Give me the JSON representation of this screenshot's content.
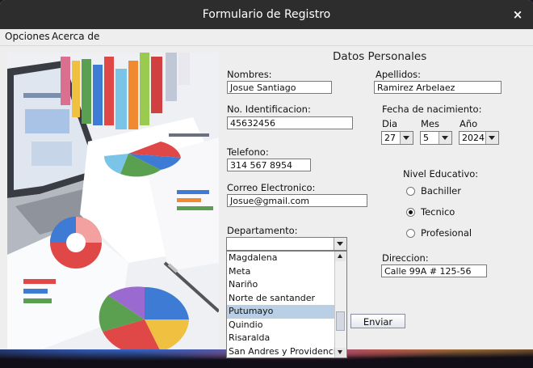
{
  "window": {
    "title": "Formulario de Registro",
    "close_glyph": "×"
  },
  "menu": {
    "items": [
      "Opciones",
      "Acerca de"
    ]
  },
  "image": {
    "icon": "business-charts-illustration"
  },
  "form": {
    "section_title": "Datos Personales",
    "nombres": {
      "label": "Nombres:",
      "value": "Josue Santiago"
    },
    "apellidos": {
      "label": "Apellidos:",
      "value": "Ramirez Arbelaez"
    },
    "identificacion": {
      "label": "No. Identificacion:",
      "value": "45632456"
    },
    "fecha": {
      "label": "Fecha de nacimiento:",
      "dia": {
        "label": "Dia",
        "value": "27"
      },
      "mes": {
        "label": "Mes",
        "value": "5"
      },
      "anio": {
        "label": "Año",
        "value": "2024"
      }
    },
    "telefono": {
      "label": "Telefono:",
      "value": "314 567 8954"
    },
    "correo": {
      "label": "Correo Electronico:",
      "value": "Josue@gmail.com"
    },
    "nivel": {
      "label": "Nivel Educativo:",
      "options": [
        "Bachiller",
        "Tecnico",
        "Profesional"
      ],
      "selected": "Tecnico"
    },
    "departamento": {
      "label": "Departamento:",
      "value": "",
      "options": [
        "Magdalena",
        "Meta",
        "Nariño",
        "Norte de santander",
        "Putumayo",
        "Quindio",
        "Risaralda",
        "San Andres y Providencia"
      ],
      "highlighted": "Putumayo"
    },
    "direccion": {
      "label": "Direccion:",
      "value": "Calle 99A # 125-56"
    },
    "submit_label": "Enviar"
  },
  "colors": {
    "titlebar": "#2d2d2d",
    "window_bg": "#eeeeee",
    "selection": "#b8cfe6"
  }
}
